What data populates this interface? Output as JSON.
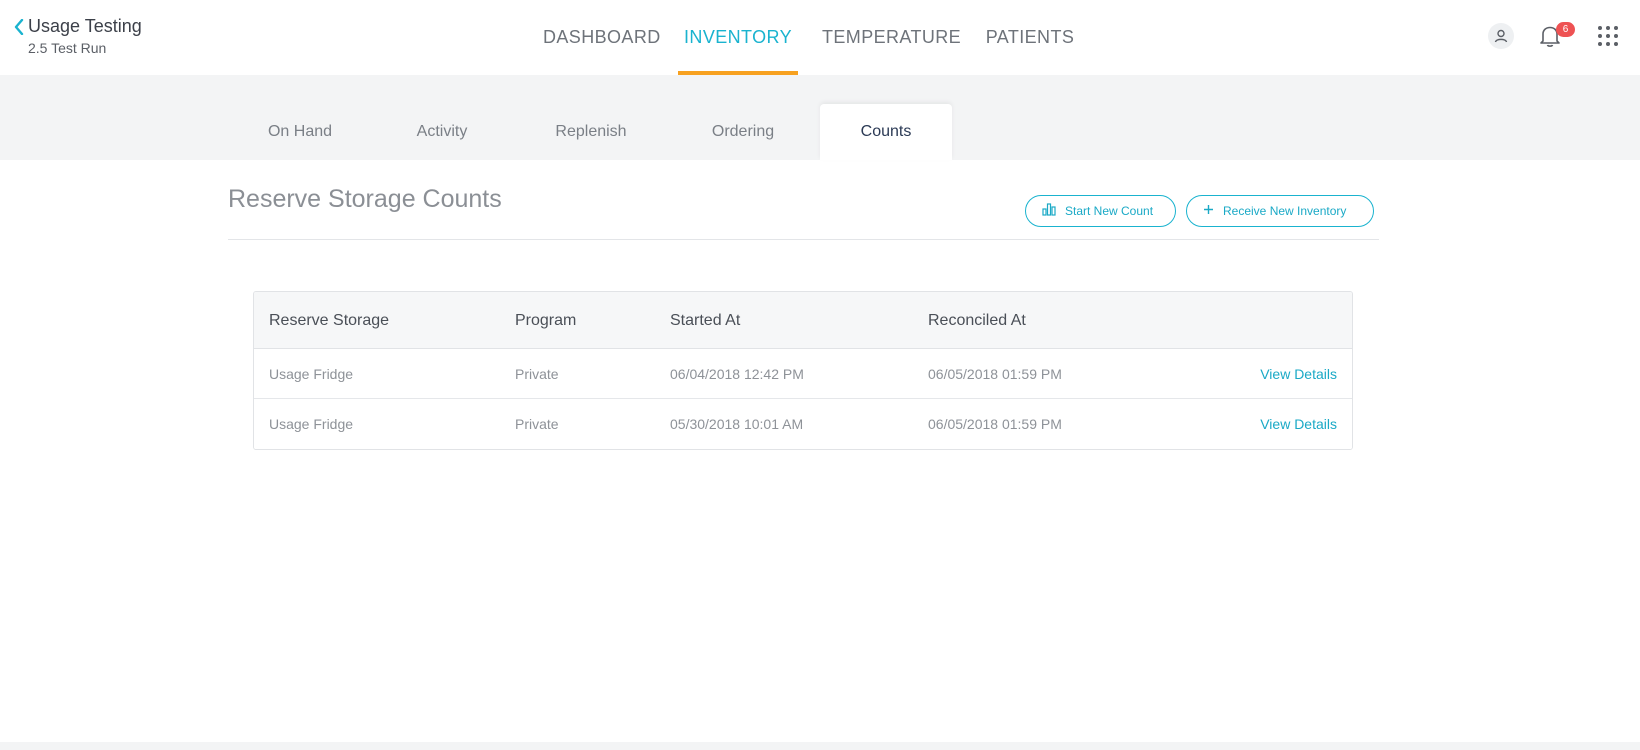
{
  "app": {
    "title": "Usage Testing",
    "subtitle": "2.5 Test Run"
  },
  "main_nav": [
    {
      "label": "DASHBOARD",
      "active": false
    },
    {
      "label": "INVENTORY",
      "active": true
    },
    {
      "label": "TEMPERATURE",
      "active": false
    },
    {
      "label": "PATIENTS",
      "active": false
    }
  ],
  "header_icons": {
    "user": "user-icon",
    "bell": "bell-icon",
    "apps": "apps-grid-icon",
    "notification_count": "6"
  },
  "sub_nav": [
    {
      "label": "On Hand",
      "active": false
    },
    {
      "label": "Activity",
      "active": false
    },
    {
      "label": "Replenish",
      "active": false
    },
    {
      "label": "Ordering",
      "active": false
    },
    {
      "label": "Counts",
      "active": true
    }
  ],
  "page": {
    "title": "Reserve Storage Counts",
    "start_count_label": "Start New Count",
    "receive_inventory_label": "Receive New Inventory"
  },
  "table": {
    "columns": [
      "Reserve Storage",
      "Program",
      "Started At",
      "Reconciled At"
    ],
    "rows": [
      {
        "storage": "Usage Fridge",
        "program": "Private",
        "started": "06/04/2018 12:42 PM",
        "reconciled": "06/05/2018 01:59 PM",
        "action": "View Details"
      },
      {
        "storage": "Usage Fridge",
        "program": "Private",
        "started": "05/30/2018 10:01 AM",
        "reconciled": "06/05/2018 01:59 PM",
        "action": "View Details"
      }
    ]
  },
  "colors": {
    "accent": "#1ab3cf",
    "active_underline": "#f7a120",
    "badge": "#ee5253"
  }
}
